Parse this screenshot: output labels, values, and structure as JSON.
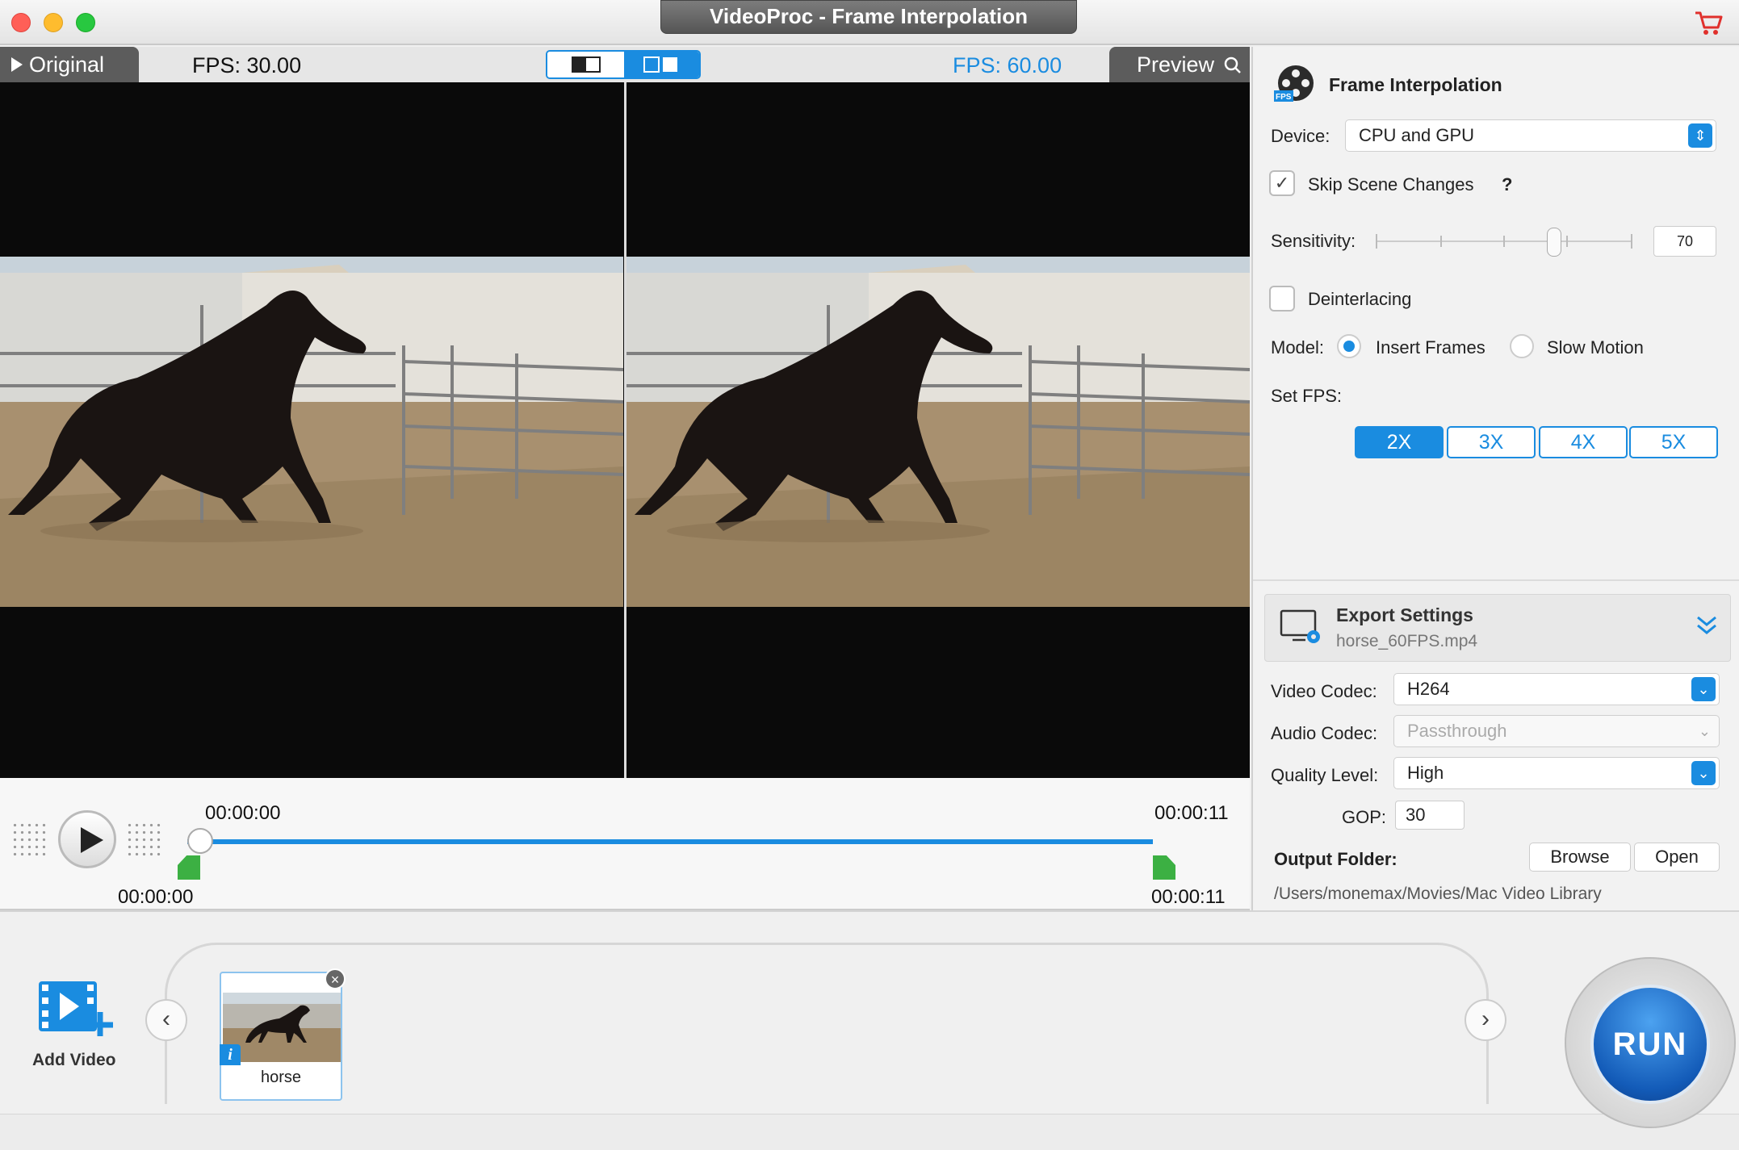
{
  "window": {
    "title": "VideoProc - Frame Interpolation"
  },
  "preview_header": {
    "original_label": "Original",
    "original_fps": "FPS: 30.00",
    "preview_label": "Preview",
    "preview_fps": "FPS: 60.00"
  },
  "timeline": {
    "current_time": "00:00:00",
    "end_time": "00:00:11",
    "trim_start": "00:00:00",
    "trim_end": "00:00:11"
  },
  "frame_interpolation": {
    "title": "Frame Interpolation",
    "device_label": "Device:",
    "device_value": "CPU and GPU",
    "skip_scene_label": "Skip Scene Changes",
    "skip_scene_checked": true,
    "help": "?",
    "sensitivity_label": "Sensitivity:",
    "sensitivity_value": "70",
    "deinterlacing_label": "Deinterlacing",
    "deinterlacing_checked": false,
    "model_label": "Model:",
    "model_insert": "Insert Frames",
    "model_slow": "Slow Motion",
    "model_selected": "Insert Frames",
    "set_fps_label": "Set FPS:",
    "fps_options": [
      "2X",
      "3X",
      "4X",
      "5X"
    ],
    "fps_selected": "2X"
  },
  "export": {
    "title": "Export Settings",
    "filename": "horse_60FPS.mp4",
    "video_codec_label": "Video Codec:",
    "video_codec": "H264",
    "audio_codec_label": "Audio Codec:",
    "audio_codec": "Passthrough",
    "quality_label": "Quality Level:",
    "quality": "High",
    "gop_label": "GOP:",
    "gop": "30",
    "output_folder_label": "Output Folder:",
    "browse": "Browse",
    "open": "Open",
    "output_path": "/Users/monemax/Movies/Mac Video Library"
  },
  "bottom": {
    "add_video": "Add Video",
    "clip_name": "horse",
    "run": "RUN"
  },
  "colors": {
    "accent": "#1a8ce0",
    "trim_handle": "#3cb043"
  }
}
